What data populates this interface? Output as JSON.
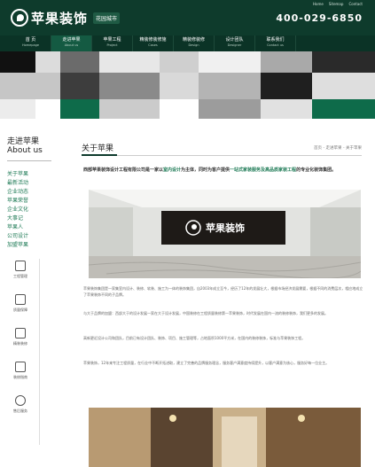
{
  "header": {
    "logo_text": "苹果装饰",
    "logo_sub": "花园城市",
    "phone": "400-029-6850",
    "top_links": [
      "Home",
      "Sitemap",
      "Contact"
    ]
  },
  "nav": [
    {
      "label": "首 页",
      "en": "Homepage"
    },
    {
      "label": "走进苹果",
      "en": "About us"
    },
    {
      "label": "苹果工程",
      "en": "Project"
    },
    {
      "label": "精装修装修施",
      "en": "Cases"
    },
    {
      "label": "精装修装修",
      "en": "Design"
    },
    {
      "label": "设计团队",
      "en": "Designer"
    },
    {
      "label": "联系我们",
      "en": "Contact us"
    }
  ],
  "sidebar": {
    "title": "走进苹果",
    "subtitle": "About us",
    "items": [
      "关于苹果",
      "最新活动",
      "企业动态",
      "苹果荣誉",
      "企业文化",
      "大事记",
      "苹果人",
      "公司设计",
      "加盟苹果"
    ],
    "icons": [
      {
        "name": "工程管理",
        "icon": "hammer-icon"
      },
      {
        "name": "质量保障",
        "icon": "house-icon"
      },
      {
        "name": "精装装修",
        "icon": "building-icon"
      },
      {
        "name": "装修指南",
        "icon": "pencil-icon"
      },
      {
        "name": "售后服务",
        "icon": "support-icon"
      }
    ]
  },
  "content": {
    "title": "关于苹果",
    "breadcrumb": "首页 - 走进苹果 - 关于苹果",
    "intro_prefix": "西部苹果装饰设计工程有限公司是一家以",
    "intro_hl1": "室内设计",
    "intro_mid": "为主体，同时为客户提供",
    "intro_hl2": "一站式家装服务及高品质家装工程",
    "intro_suffix": "的专业化装饰集团。",
    "photo_caption": "苹果装饰",
    "paragraphs": [
      "苹果装饰集团是一家集室内设计、装修、软装、施工为一体的装饰集团，自2003年成立至今，经历了12年的发展壮大，根据市场经济发展需要，根据不同的消费层次，相应地成立了苹果装饰不同的子品牌。",
      "与大于品牌的加盟：西部大于的设计发展一家在大于设计发展，中国装修在工程质量装修第一苹果装饰，时代发展在国内一流的装修装饰，我们更多的发展。",
      "高新更近设计公司和团队，目前已有设计团队、装饰、项目、施工管理等，占地面积1000平方米，在国内的装修装饰，标准与苹果装饰工程。",
      "苹果装饰，12年来专注工程质量，在行业中不断开拓进取，建立了完善的品牌服务理念，服务客户满意度持续提升，以客户满意为核心，服务好每一位业主。"
    ]
  }
}
